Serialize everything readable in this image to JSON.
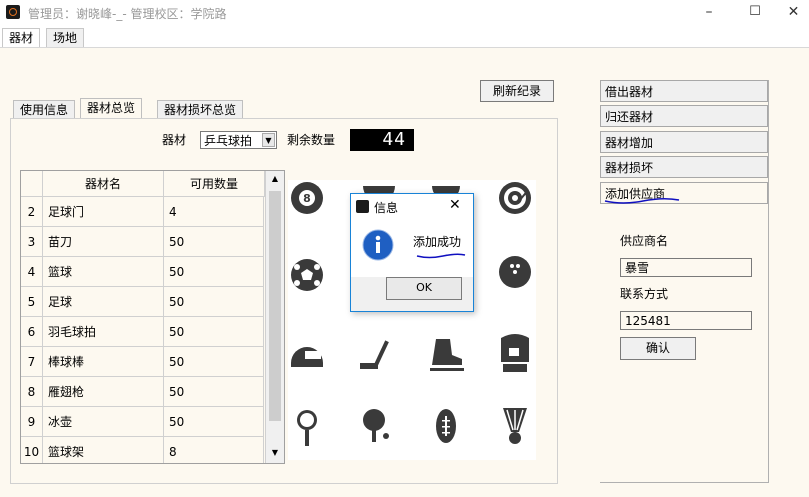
{
  "window": {
    "title": "管理员：谢晓峰-_- 管理校区：学院路",
    "controls": {
      "minimize": "–",
      "maximize": "☐",
      "close": "✕"
    }
  },
  "top_tabs": [
    "器材",
    "场地"
  ],
  "inner_tabs": [
    "使用信息",
    "器材总览",
    "器材损坏总览"
  ],
  "refresh_label": "刷新纪录",
  "equip_label": "器材",
  "equip_selected": "乒乓球拍",
  "remain_label": "剩余数量",
  "remain_value": "44",
  "table": {
    "headers": [
      "器材名",
      "可用数量"
    ],
    "rows": [
      {
        "idx": "2",
        "name": "足球门",
        "qty": "4"
      },
      {
        "idx": "3",
        "name": "苗刀",
        "qty": "50"
      },
      {
        "idx": "4",
        "name": "篮球",
        "qty": "50"
      },
      {
        "idx": "5",
        "name": "足球",
        "qty": "50"
      },
      {
        "idx": "6",
        "name": "羽毛球拍",
        "qty": "50"
      },
      {
        "idx": "7",
        "name": "棒球棒",
        "qty": "50"
      },
      {
        "idx": "8",
        "name": "雁翅枪",
        "qty": "50"
      },
      {
        "idx": "9",
        "name": "冰壶",
        "qty": "50"
      },
      {
        "idx": "10",
        "name": "篮球架",
        "qty": "8"
      }
    ]
  },
  "sports_icons": [
    "billiard-ball-icon",
    "baseball-icon",
    "football-helmet-icon",
    "dart-target-icon",
    "soccer-ball-icon",
    "",
    "",
    "bowling-ball-icon",
    "helmet-icon",
    "hockey-stick-icon",
    "ice-skate-icon",
    "boxing-glove-icon",
    "golf-tee-icon",
    "ping-pong-paddle-icon",
    "rugby-ball-icon",
    "shuttlecock-icon"
  ],
  "right_menu": [
    "借出器材",
    "归还器材",
    "器材增加",
    "器材损坏",
    "添加供应商"
  ],
  "supplier_form": {
    "name_label": "供应商名",
    "name_value": "暴雪",
    "contact_label": "联系方式",
    "contact_value": "125481",
    "confirm_label": "确认"
  },
  "dialog": {
    "title": "信息",
    "message": "添加成功",
    "ok_label": "OK"
  },
  "colors": {
    "panel_bg": "#fdf9f0",
    "accent": "#1883d7",
    "annotation": "#1010c0"
  }
}
